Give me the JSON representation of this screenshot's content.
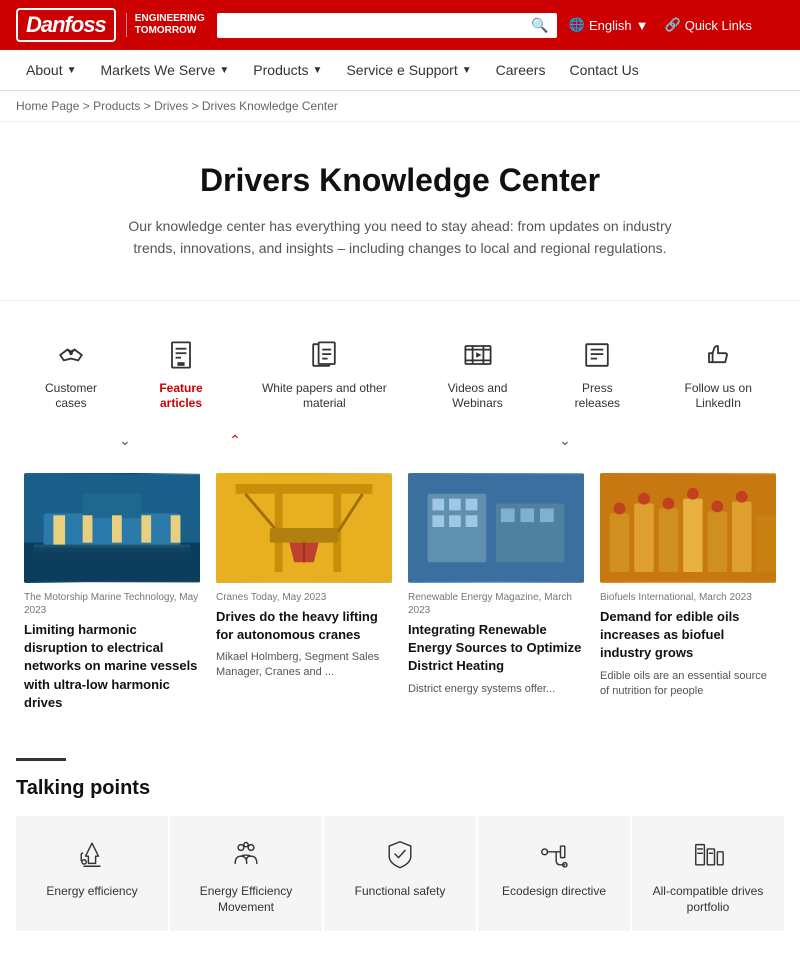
{
  "header": {
    "logo": "Danfoss",
    "tagline": "ENGINEERING\nTOMORROW",
    "search_placeholder": "",
    "lang": "English",
    "quicklinks": "Quick Links"
  },
  "nav": {
    "items": [
      {
        "label": "About",
        "has_dropdown": true
      },
      {
        "label": "Markets We Serve",
        "has_dropdown": true
      },
      {
        "label": "Products",
        "has_dropdown": true
      },
      {
        "label": "Service e Support",
        "has_dropdown": true
      },
      {
        "label": "Careers",
        "has_dropdown": false
      },
      {
        "label": "Contact Us",
        "has_dropdown": false
      }
    ]
  },
  "breadcrumb": {
    "items": [
      "Home Page",
      "Products",
      "Drives",
      "Drives Knowledge Center"
    ]
  },
  "page": {
    "title": "Drivers Knowledge Center",
    "description": "Our knowledge center has everything you need to stay ahead: from updates on industry trends, innovations, and insights – including changes to local and regional regulations."
  },
  "categories": [
    {
      "id": "customer-cases",
      "label": "Customer cases",
      "active": false
    },
    {
      "id": "feature-articles",
      "label": "Feature articles",
      "active": true
    },
    {
      "id": "white-papers",
      "label": "White papers and other material",
      "active": false
    },
    {
      "id": "videos",
      "label": "Videos and Webinars",
      "active": false
    },
    {
      "id": "press-releases",
      "label": "Press releases",
      "active": false
    },
    {
      "id": "linkedin",
      "label": "Follow us on LinkedIn",
      "active": false
    }
  ],
  "articles": [
    {
      "source": "The Motorship Marine Technology, May 2023",
      "title": "Limiting harmonic disruption to electrical networks on marine vessels with ultra-low harmonic drives",
      "author": "",
      "description": "",
      "img_type": "ship"
    },
    {
      "source": "Cranes Today, May 2023",
      "title": "Drives do the heavy lifting for autonomous cranes",
      "author": "Mikael Holmberg, Segment Sales Manager, Cranes and ...",
      "description": "",
      "img_type": "crane"
    },
    {
      "source": "Renewable Energy Magazine, March 2023",
      "title": "Integrating Renewable Energy Sources to Optimize District Heating",
      "author": "",
      "description": "District energy systems offer...",
      "img_type": "energy"
    },
    {
      "source": "Biofuels International, March 2023",
      "title": "Demand for edible oils increases as biofuel industry grows",
      "author": "",
      "description": "Edible oils are an essential source of nutrition for people",
      "img_type": "biofuel"
    }
  ],
  "talking_points": {
    "section_title": "Talking points",
    "items": [
      {
        "id": "energy-efficiency",
        "label": "Energy efficiency"
      },
      {
        "id": "energy-efficiency-movement",
        "label": "Energy Efficiency Movement"
      },
      {
        "id": "functional-safety",
        "label": "Functional safety"
      },
      {
        "id": "ecodesign-directive",
        "label": "Ecodesign directive"
      },
      {
        "id": "all-compatible",
        "label": "All-compatible drives portfolio"
      }
    ]
  }
}
